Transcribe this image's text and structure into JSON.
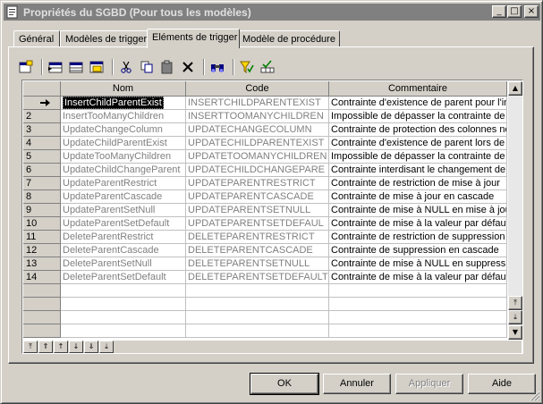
{
  "window": {
    "title": "Propriétés du SGBD (Pour tous les modèles)",
    "controls": {
      "minimize": "_",
      "maximize": "□",
      "close": "×"
    }
  },
  "tabs": [
    {
      "label": "Général",
      "active": false
    },
    {
      "label": "Modèles de trigger",
      "active": false
    },
    {
      "label": "Eléments de trigger",
      "active": true
    },
    {
      "label": "Modèle de procédure",
      "active": false
    }
  ],
  "toolbar": {
    "icons": [
      "properties-icon",
      "insert-row-icon",
      "add-row-icon",
      "add-rows-icon",
      "cut-icon",
      "copy-icon",
      "paste-icon",
      "delete-icon",
      "find-icon",
      "filter-icon",
      "customize-columns-icon"
    ]
  },
  "grid": {
    "columns": [
      "Nom",
      "Code",
      "Commentaire"
    ],
    "rows": [
      {
        "num": "",
        "current": true,
        "name": "InsertChildParentExist",
        "code": "INSERTCHILDPARENTEXIST",
        "comment": "Contrainte d'existence de parent pour l'ins"
      },
      {
        "num": "2",
        "name": "InsertTooManyChildren",
        "code": "INSERTTOOMANYCHILDREN",
        "comment": "Impossible de dépasser la contrainte de c"
      },
      {
        "num": "3",
        "name": "UpdateChangeColumn",
        "code": "UPDATECHANGECOLUMN",
        "comment": "Contrainte de protection des colonnes no"
      },
      {
        "num": "4",
        "name": "UpdateChildParentExist",
        "code": "UPDATECHILDPARENTEXIST",
        "comment": "Contrainte d'existence de parent lors de l"
      },
      {
        "num": "5",
        "name": "UpdateTooManyChildren",
        "code": "UPDATETOOMANYCHILDREN",
        "comment": "Impossible de dépasser la contrainte de c"
      },
      {
        "num": "6",
        "name": "UpdateChildChangeParent",
        "code": "UPDATECHILDCHANGEPARE",
        "comment": "Contrainte interdisant le changement de p"
      },
      {
        "num": "7",
        "name": "UpdateParentRestrict",
        "code": "UPDATEPARENTRESTRICT",
        "comment": "Contrainte de restriction de mise à jour"
      },
      {
        "num": "8",
        "name": "UpdateParentCascade",
        "code": "UPDATEPARENTCASCADE",
        "comment": "Contrainte de mise à jour en cascade"
      },
      {
        "num": "9",
        "name": "UpdateParentSetNull",
        "code": "UPDATEPARENTSETNULL",
        "comment": "Contrainte de mise à NULL en mise à jour"
      },
      {
        "num": "10",
        "name": "UpdateParentSetDefault",
        "code": "UPDATEPARENTSETDEFAUL",
        "comment": "Contrainte de mise à la valeur par défaut"
      },
      {
        "num": "11",
        "name": "DeleteParentRestrict",
        "code": "DELETEPARENTRESTRICT",
        "comment": "Contrainte de restriction de suppression"
      },
      {
        "num": "12",
        "name": "DeleteParentCascade",
        "code": "DELETEPARENTCASCADE",
        "comment": "Contrainte de suppression en cascade"
      },
      {
        "num": "13",
        "name": "DeleteParentSetNull",
        "code": "DELETEPARENTSETNULL",
        "comment": "Contrainte de mise à NULL en suppressio"
      },
      {
        "num": "14",
        "name": "DeleteParentSetDefault",
        "code": "DELETEPARENTSETDEFAULT",
        "comment": "Contrainte de mise à la valeur par défaut"
      }
    ],
    "empty_rows": 4
  },
  "buttons": {
    "ok": "OK",
    "cancel": "Annuler",
    "apply": "Appliquer",
    "help": "Aide"
  }
}
